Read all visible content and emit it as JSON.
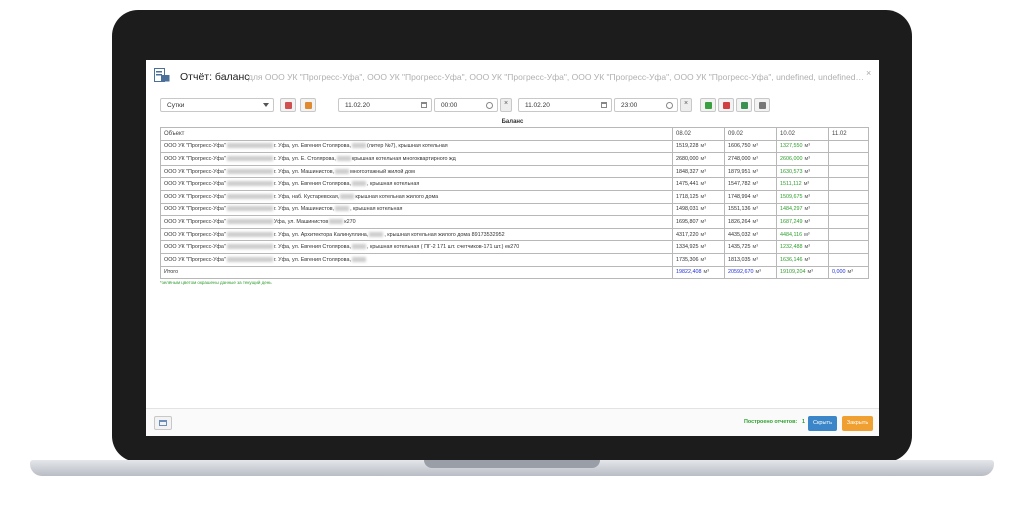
{
  "dialog": {
    "title": "Отчёт: баланс",
    "subtitle": "для ООО УК \"Прогресс-Уфа\", ООО УК \"Прогресс-Уфа\", ООО УК \"Прогресс-Уфа\", ООО УК \"Прогресс-Уфа\", ООО УК \"Прогресс-Уфа\", undefined, undefined, undefined...",
    "close": "×"
  },
  "toolbar": {
    "period": "Сутки",
    "date_from": "11.02.20",
    "time_from": "00:00",
    "date_to": "11.02.20",
    "time_to": "23:00",
    "clear": "×"
  },
  "colors": {
    "green": "#2e9e2e",
    "blue_total": "#2233dd",
    "hide_btn": "#3a86c8",
    "close_btn": "#f0a030"
  },
  "table": {
    "caption": "Баланс",
    "headers": [
      "Объект",
      "08.02",
      "09.02",
      "10.02",
      "11.02"
    ],
    "unit": "м³",
    "rows": [
      {
        "pre": "ООО УК \"Прогресс-Уфа\"",
        "post": "г. Уфа, ул. Евгения Столярова,",
        "post2": "(литер №7), крышная котельная",
        "v1": "1519,228",
        "v2": "1606,750",
        "v3": "1327,550"
      },
      {
        "pre": "ООО УК \"Прогресс-Уфа\"",
        "post": "г. Уфа, ул. Е. Столярова,",
        "post2": "крышная котельная многоквартирного жд",
        "v1": "2680,000",
        "v2": "2748,000",
        "v3": "2606,000"
      },
      {
        "pre": "ООО УК \"Прогресс-Уфа\"",
        "post": "г. Уфа, ул. Машинистов,",
        "post2": "многоэтажный жилой дом",
        "v1": "1848,327",
        "v2": "1879,951",
        "v3": "1630,573"
      },
      {
        "pre": "ООО УК \"Прогресс-Уфа\"",
        "post": "г. Уфа, ул. Евгения Столярова,",
        "post2": ", крышная котельная",
        "v1": "1475,441",
        "v2": "1547,782",
        "v3": "1511,112"
      },
      {
        "pre": "ООО УК \"Прогресс-Уфа\"",
        "post": "г. Уфа, наб. Кустаревская,",
        "post2": "крышная котельная жилого дома",
        "v1": "1718,125",
        "v2": "1748,994",
        "v3": "1509,675"
      },
      {
        "pre": "ООО УК \"Прогресс-Уфа\"",
        "post": "г. Уфа, ул. Машинистов,",
        "post2": ", крышная котельная",
        "v1": "1498,031",
        "v2": "1551,136",
        "v3": "1484,297"
      },
      {
        "pre": "ООО УК \"Прогресс-Уфа\"",
        "post": "Уфа, ул. Машинистов",
        "post2": "к270",
        "v1": "1695,807",
        "v2": "1826,264",
        "v3": "1687,249"
      },
      {
        "pre": "ООО УК \"Прогресс-Уфа\"",
        "post": "г. Уфа, ул. Архитектора Калинуллина,",
        "post2": ", крышная котельная жилого дома 89173532952",
        "v1": "4317,220",
        "v2": "4435,032",
        "v3": "4484,116"
      },
      {
        "pre": "ООО УК \"Прогресс-Уфа\"",
        "post": "г. Уфа, ул. Евгения Столярова,",
        "post2": ", крышная котельная ( ПГ-2 171 шт. счетчиков-171 шт.) ек270",
        "v1": "1334,925",
        "v2": "1435,725",
        "v3": "1232,488"
      },
      {
        "pre": "ООО УК \"Прогресс-Уфа\"",
        "post": "г. Уфа, ул. Евгения Столярова,",
        "post2": "",
        "v1": "1735,306",
        "v2": "1813,035",
        "v3": "1636,146"
      }
    ],
    "total": {
      "label": "Итого",
      "v1": "19822,408",
      "v2": "20592,670",
      "v3": "19109,204",
      "v4": "0,000"
    }
  },
  "footnote": "*зелёным цветом окрашены данные за текущий день",
  "footer": {
    "built_label": "Построено отчетов:",
    "built_count": "1",
    "hide_label": "Скрыть",
    "close_label": "Закрыть"
  }
}
